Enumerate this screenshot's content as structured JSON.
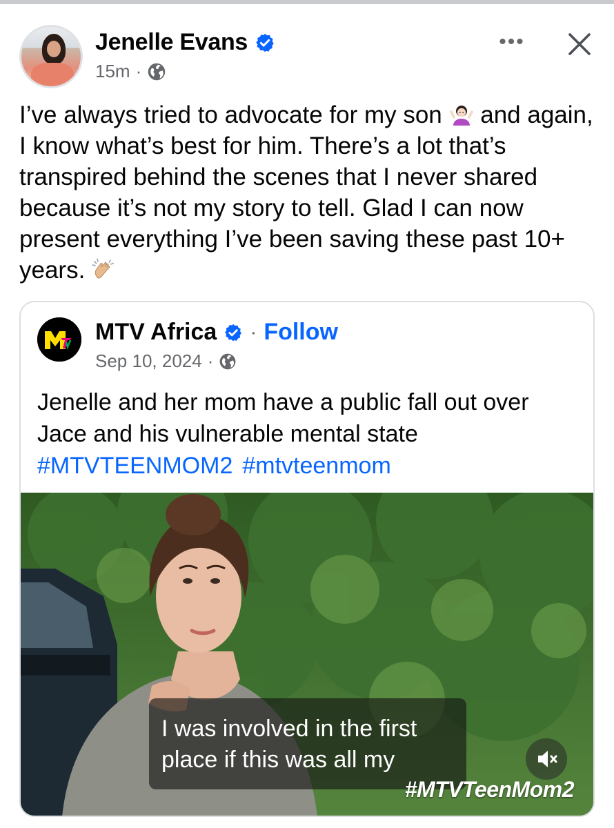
{
  "post": {
    "author": "Jenelle Evans",
    "time": "15m",
    "separator": "·",
    "more_label": "•••",
    "text_parts": [
      "I’ve always tried to advocate for my son ",
      " and again, I know what’s best for him. There’s a lot that’s transpired behind the scenes that I never shared because it’s not my story to tell. Glad I can now present everything I’ve been saving these past 10+ years. "
    ]
  },
  "shared": {
    "page_name": "MTV Africa",
    "separator": "·",
    "follow_label": "Follow",
    "date": "Sep 10, 2024",
    "text": "Jenelle and her mom have a public fall out over Jace and his vulnerable mental state",
    "hashtags": [
      "#MTVTEENMOM2",
      "#mtvteenmom"
    ],
    "video": {
      "subtitle_line1": "I was involved in the first",
      "subtitle_line2": "place if this was all my",
      "watermark": "#MTVTeenMom2"
    }
  },
  "colors": {
    "link_blue": "#0866ff",
    "verified_blue": "#0866ff",
    "meta_gray": "#65676b",
    "card_border": "#dadde1"
  },
  "icons": {
    "verified": "verified-badge-icon",
    "privacy": "globe-icon",
    "more": "more-options-icon",
    "close": "close-icon",
    "mute": "muted-speaker-icon",
    "emoji_1": "person-shrugging-emoji",
    "emoji_2": "clapping-hands-emoji"
  }
}
